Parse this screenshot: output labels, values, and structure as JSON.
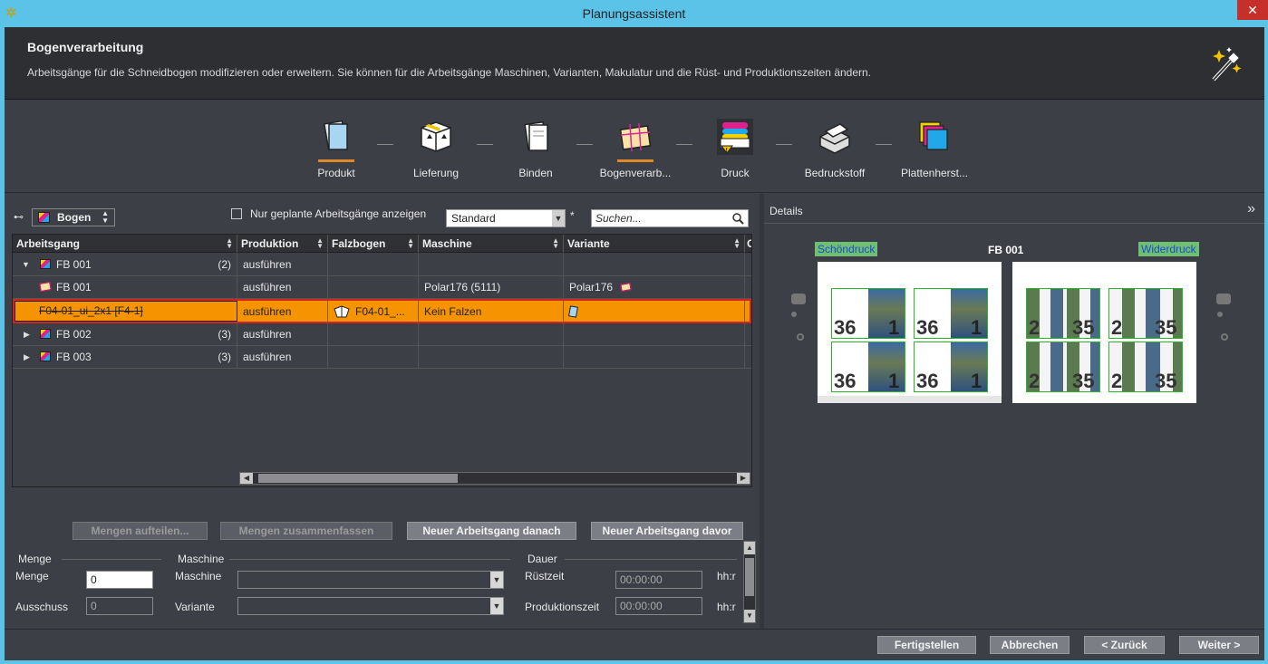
{
  "window": {
    "title": "Planungsassistent",
    "close": "✕"
  },
  "header": {
    "title": "Bogenverarbeitung",
    "description": "Arbeitsgänge für die Schneidbogen modifizieren oder erweitern. Sie können für die Arbeitsgänge Maschinen, Varianten, Makulatur und die Rüst- und Produktionszeiten ändern."
  },
  "steps": [
    {
      "label": "Produkt",
      "icon": "product-icon",
      "underline": true
    },
    {
      "label": "Lieferung",
      "icon": "delivery-box-icon",
      "underline": false
    },
    {
      "label": "Binden",
      "icon": "binding-icon",
      "underline": false
    },
    {
      "label": "Bogenverarb...",
      "icon": "sheet-processing-icon",
      "underline": true
    },
    {
      "label": "Druck",
      "icon": "print-warning-icon",
      "underline": false
    },
    {
      "label": "Bedruckstoff",
      "icon": "paper-stock-icon",
      "underline": false
    },
    {
      "label": "Plattenherst...",
      "icon": "plate-making-icon",
      "underline": false
    }
  ],
  "toolbar": {
    "group_label": "Bogen",
    "only_planned_label": "Nur geplante Arbeitsgänge anzeigen",
    "only_planned_checked": false,
    "view_select": "Standard",
    "modified_marker": "*",
    "search_placeholder": "Suchen..."
  },
  "grid": {
    "columns": [
      "Arbeitsgang",
      "Produktion",
      "Falzbogen",
      "Maschine",
      "Variante",
      "C"
    ],
    "rows": [
      {
        "name": "FB 001",
        "count": "(2)",
        "produktion": "ausführen",
        "falzbogen": "",
        "maschine": "",
        "variante": "",
        "expanded": true
      },
      {
        "name": "FB 001",
        "count": "",
        "produktion": "ausführen",
        "falzbogen": "",
        "maschine": "Polar176 (5111)",
        "variante": "Polar176"
      },
      {
        "name": "F04-01_ui_2x1 [F4-1]",
        "count": "",
        "produktion": "ausführen",
        "falzbogen": "F04-01_...",
        "maschine": "Kein Falzen",
        "variante": "",
        "selected": true
      },
      {
        "name": "FB 002",
        "count": "(3)",
        "produktion": "ausführen",
        "falzbogen": "",
        "maschine": "",
        "variante": ""
      },
      {
        "name": "FB 003",
        "count": "(3)",
        "produktion": "ausführen",
        "falzbogen": "",
        "maschine": "",
        "variante": ""
      }
    ]
  },
  "actions": {
    "split": "Mengen aufteilen...",
    "merge": "Mengen zusammenfassen",
    "new_after": "Neuer Arbeitsgang danach",
    "new_before": "Neuer Arbeitsgang davor"
  },
  "form": {
    "menge_group": "Menge",
    "menge_label": "Menge",
    "menge_value": "0",
    "ausschuss_label": "Ausschuss",
    "ausschuss_value": "0",
    "maschine_group": "Maschine",
    "maschine_label": "Maschine",
    "maschine_value": "",
    "variante_label": "Variante",
    "variante_value": "",
    "dauer_group": "Dauer",
    "ruestzeit_label": "Rüstzeit",
    "ruestzeit_value": "00:00:00",
    "produktionszeit_label": "Produktionszeit",
    "produktionszeit_value": "00:00:00",
    "unit": "hh:r"
  },
  "details": {
    "title": "Details",
    "front_label": "Schöndruck",
    "back_label": "Widerdruck",
    "sheet_name": "FB 001",
    "front_pages": [
      "36",
      "1",
      "36",
      "1",
      "36",
      "1",
      "36",
      "1"
    ],
    "back_pages": [
      "2",
      "35",
      "2",
      "35",
      "2",
      "35",
      "2",
      "35"
    ]
  },
  "footer": {
    "finish": "Fertigstellen",
    "cancel": "Abbrechen",
    "back": "< Zurück",
    "next": "Weiter >"
  },
  "colors": {
    "accent": "#f59300",
    "selection_border": "#d32424",
    "tag_bg": "#6fbf73",
    "titlebar": "#5bc3e8"
  }
}
